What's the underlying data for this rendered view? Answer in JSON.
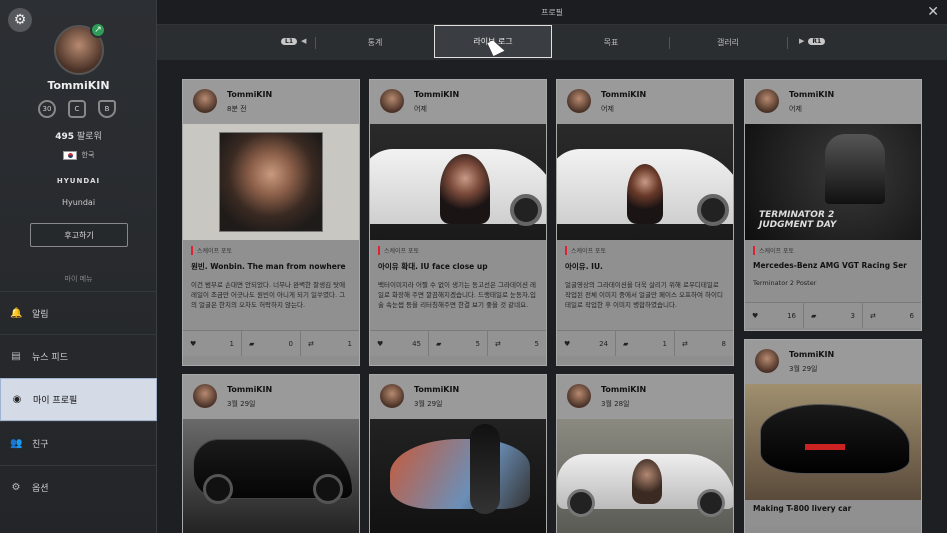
{
  "window": {
    "title": "프로필",
    "close": "✕"
  },
  "profile": {
    "name": "TommiKIN",
    "level": "30",
    "followers_count": "495",
    "followers_label": "팔로워",
    "country": "한국",
    "brand_logo": "HYUNDAI",
    "brand_name": "Hyundai",
    "follow_button": "후고하기",
    "menu_label": "마이 메뉴"
  },
  "nav": [
    {
      "label": "알림",
      "icon": "🔔"
    },
    {
      "label": "뉴스 피드",
      "icon": "▤"
    },
    {
      "label": "마이 프로필",
      "icon": "◉"
    },
    {
      "label": "친구",
      "icon": "👥"
    },
    {
      "label": "옵션",
      "icon": "⚙"
    }
  ],
  "tabs": {
    "l1": "L1",
    "r1": "R1",
    "items": [
      "통계",
      "라이브 로그",
      "목표",
      "갤러리"
    ],
    "selected": 1
  },
  "cards": [
    {
      "user": "TommiKIN",
      "time": "8분 전",
      "tag": "스케이프 포토",
      "title": "원빈. Wonbin. The man from nowhere",
      "desc": "이건 범부로 손대면 안되었다. 너무나 완벽한 잘생김 탓에 레일이 조금만 어긋나도 원빈이 아니게 되기 일쑤였다. 그의 얼굴은 한치의 오차도 허락하지 않는다.",
      "likes": "1",
      "comments": "0",
      "shares": "1"
    },
    {
      "user": "TommiKIN",
      "time": "어제",
      "tag": "스케이프 포토",
      "title": "아이유 확대. IU face close up",
      "desc": "백터이미지라 어찔 수 없이 생기는 동고선은 그라데이션 레일로 화장해 주면 깔끔해지겠습니다. 드랭태일로 눈동자,입술 속눈썹 등을 리터칭해주면 한결 보기 좋을 것 같네요.",
      "likes": "45",
      "comments": "5",
      "shares": "5"
    },
    {
      "user": "TommiKIN",
      "time": "어제",
      "tag": "스케이프 포토",
      "title": "아이유. IU.",
      "desc": "얼굴영상의 그라데이션을 더욱 살리기 위해 로우디테일로 작업된 전체 이미지 중에서 얼굴만 페이스 오프하여 하이디테일로 작업한 후 이미지 병합하였습니다.",
      "likes": "24",
      "comments": "1",
      "shares": "8"
    },
    {
      "user": "TommiKIN",
      "time": "어제",
      "tag": "스케이프 포토",
      "title": "Mercedes-Benz AMG VGT Racing Ser",
      "desc": "Terminator 2 Poster",
      "likes": "16",
      "comments": "3",
      "shares": "6"
    },
    {
      "user": "TommiKIN",
      "time": "3월 29일"
    },
    {
      "user": "TommiKIN",
      "time": "3월 29일"
    },
    {
      "user": "TommiKIN",
      "time": "3월 28일"
    },
    {
      "user": "TommiKIN",
      "time": "3월 29일",
      "title": "Making T-800 livery car"
    }
  ],
  "poster_text": "TERMINATOR 2\nJUDGMENT DAY"
}
